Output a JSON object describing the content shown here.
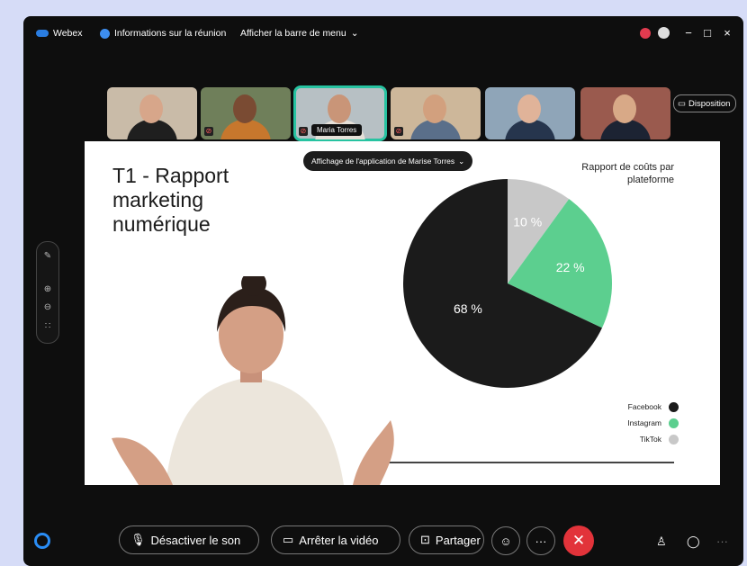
{
  "titlebar": {
    "app_name": "Webex",
    "meeting_info": "Informations sur la réunion",
    "menu_toggle": "Afficher la barre de menu"
  },
  "participants": [
    {
      "name": "",
      "muted": false,
      "skin": "#d7a68a",
      "shirt": "#1f1f1f",
      "bg": "#c9bba8"
    },
    {
      "name": "",
      "muted": true,
      "skin": "#7a4b33",
      "shirt": "#c7772d",
      "bg": "#6f7f5a"
    },
    {
      "name": "Maria Torres",
      "muted": true,
      "skin": "#c99578",
      "shirt": "#e6e0d8",
      "bg": "#b7c0c4",
      "active": true
    },
    {
      "name": "",
      "muted": true,
      "skin": "#d2a07e",
      "shirt": "#5a6f8a",
      "bg": "#cdb79a"
    },
    {
      "name": "",
      "muted": false,
      "skin": "#e0b399",
      "shirt": "#26354d",
      "bg": "#8fa5b8"
    },
    {
      "name": "",
      "muted": false,
      "skin": "#d8a987",
      "shirt": "#1c2333",
      "bg": "#9a5a4e"
    }
  ],
  "layout_button": "Disposition",
  "slide": {
    "title": "T1 - Rapport marketing numérique",
    "share_label": "Affichage de l'application de Marise Torres",
    "chart_title": "Rapport de coûts par plateforme"
  },
  "chart_data": {
    "type": "pie",
    "title": "Rapport de coûts par plateforme",
    "categories": [
      "Facebook",
      "Instagram",
      "TikTok"
    ],
    "values": [
      68,
      22,
      10
    ],
    "labels": [
      "68 %",
      "22 %",
      "10 %"
    ],
    "colors": [
      "#1b1b1b",
      "#5ccf8f",
      "#c8c8c8"
    ],
    "legend": "bottom-right"
  },
  "controls": {
    "mute": "Désactiver le son",
    "stop_video": "Arrêter la vidéo",
    "share": "Partager"
  }
}
